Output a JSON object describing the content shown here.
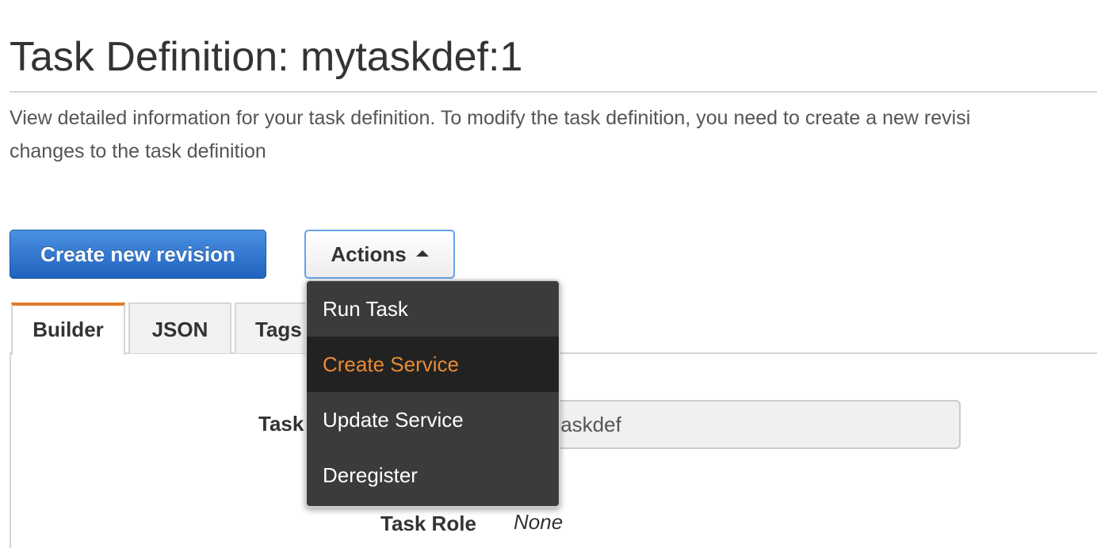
{
  "page": {
    "title": "Task Definition: mytaskdef:1",
    "description_line1": "View detailed information for your task definition. To modify the task definition, you need to create a new revisi",
    "description_line2": "changes to the task definition"
  },
  "toolbar": {
    "create_revision_label": "Create new revision",
    "actions_label": "Actions"
  },
  "tabs": [
    {
      "label": "Builder",
      "active": true
    },
    {
      "label": "JSON",
      "active": false
    },
    {
      "label": "Tags",
      "active": false
    }
  ],
  "fields": {
    "task_definition_name_label": "Task",
    "task_definition_name_value": "mytaskdef",
    "task_definition_name_visible": "taskdef",
    "task_role_label": "Task Role",
    "task_role_value": "None"
  },
  "actions_menu": {
    "items": [
      {
        "label": "Run Task",
        "highlighted": false
      },
      {
        "label": "Create Service",
        "highlighted": true
      },
      {
        "label": "Update Service",
        "highlighted": false
      },
      {
        "label": "Deregister",
        "highlighted": false
      }
    ]
  },
  "colors": {
    "primary_button": "#2063bf",
    "active_tab_accent": "#e07b27",
    "menu_background": "#3b3b3b",
    "menu_highlight_text": "#e88b34"
  },
  "icons": {
    "actions_caret": "caret-up-icon"
  }
}
